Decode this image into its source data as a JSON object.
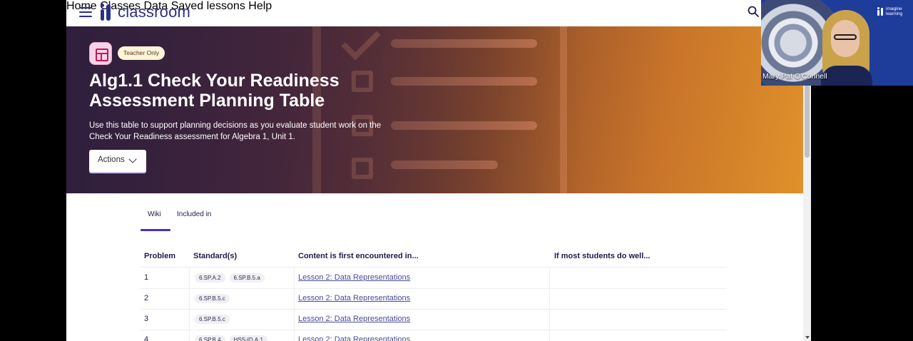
{
  "header": {
    "logo_text": "classroom",
    "nav": [
      "Home",
      "Classes",
      "Data",
      "Saved lessons",
      "Help"
    ]
  },
  "hero": {
    "badge": "Teacher Only",
    "title": "Alg1.1 Check Your Readiness Assessment Planning Table",
    "description": "Use this table to support planning decisions as you evaluate student work on the Check Your Readiness assessment for Algebra 1, Unit 1.",
    "actions_label": "Actions"
  },
  "tabs": [
    "Wiki",
    "Included in"
  ],
  "table": {
    "headers": [
      "Problem",
      "Standard(s)",
      "Content is first encountered in...",
      "If most students do well..."
    ],
    "rows": [
      {
        "problem": "1",
        "standards": [
          "6.SP.A.2",
          "6.SP.B.5.a"
        ],
        "content": "Lesson 2: Data Representations",
        "well": ""
      },
      {
        "problem": "2",
        "standards": [
          "6.SP.B.5.c"
        ],
        "content": "Lesson 2: Data Representations",
        "well": ""
      },
      {
        "problem": "3",
        "standards": [
          "6.SP.B.5.c"
        ],
        "content": "Lesson 2: Data Representations",
        "well": ""
      },
      {
        "problem": "4",
        "standards": [
          "6.SP.B.4",
          "HSS-ID.A.1"
        ],
        "content": "Lesson 2: Data Representations",
        "well": ""
      }
    ]
  },
  "video": {
    "participant": "Mary Pat O'Connell",
    "brand_line1": "imagine",
    "brand_line2": "learning"
  },
  "colors": {
    "brand": "#2a2f87",
    "tab_accent": "#4b2fbf",
    "badge_bg": "#fdf3d9"
  }
}
